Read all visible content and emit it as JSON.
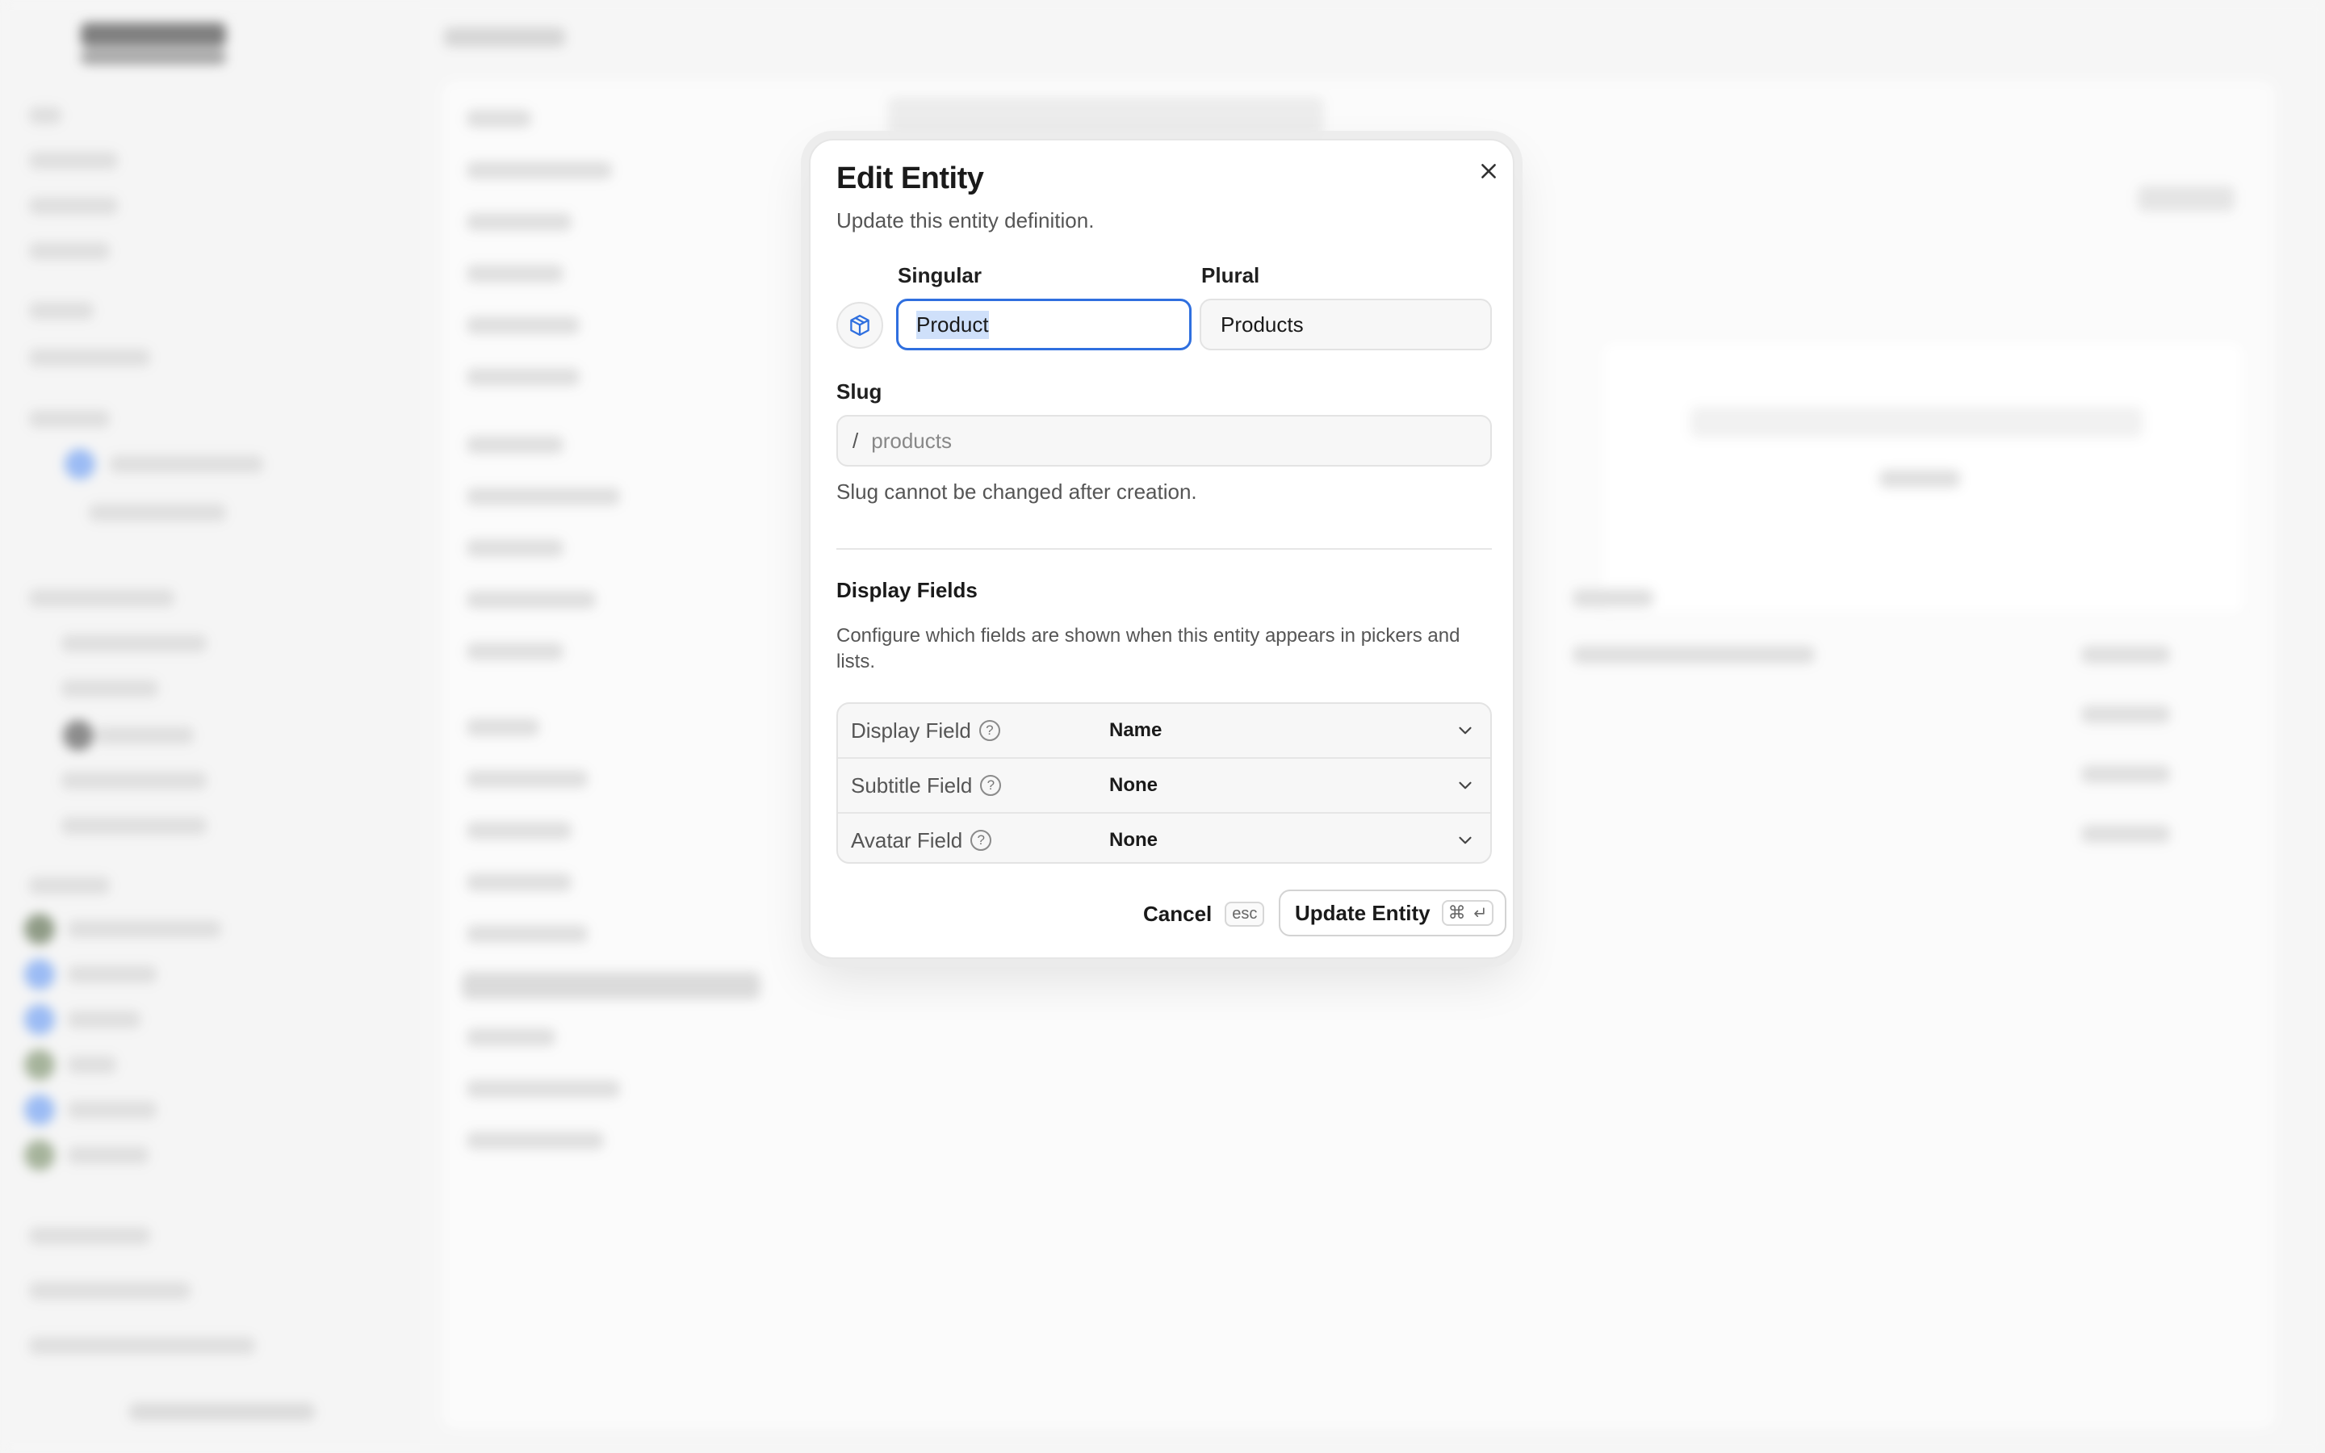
{
  "dialog": {
    "title": "Edit Entity",
    "subtitle": "Update this entity definition.",
    "close_icon": "close-icon",
    "entity_icon": "cube-icon",
    "singular": {
      "label": "Singular",
      "value": "Product"
    },
    "plural": {
      "label": "Plural",
      "value": "Products"
    },
    "slug": {
      "label": "Slug",
      "prefix": "/",
      "placeholder": "products",
      "hint": "Slug cannot be changed after creation."
    },
    "display_fields": {
      "title": "Display Fields",
      "description": "Configure which fields are shown when this entity appears in pickers and lists.",
      "rows": [
        {
          "label": "Display Field",
          "value": "Name"
        },
        {
          "label": "Subtitle Field",
          "value": "None"
        },
        {
          "label": "Avatar Field",
          "value": "None"
        }
      ]
    },
    "cancel": {
      "label": "Cancel",
      "shortcut": "esc"
    },
    "submit": {
      "label": "Update Entity",
      "shortcut": "⌘"
    }
  },
  "colors": {
    "accent": "#2f6fdf",
    "selection": "#cfe0fa"
  }
}
